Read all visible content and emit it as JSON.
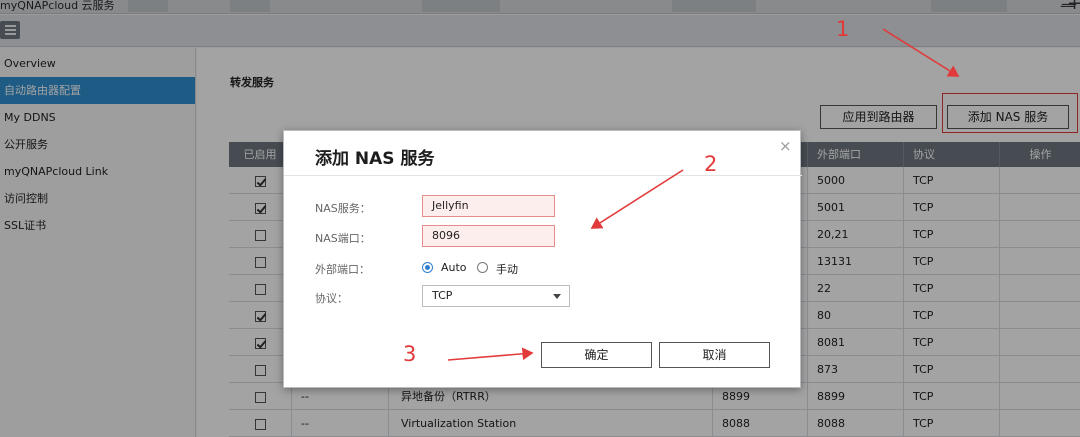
{
  "window": {
    "title": "myQNAPcloud 云服务",
    "minimize_glyph": "—",
    "add_glyph": "+"
  },
  "sidebar": {
    "items": [
      {
        "label": "Overview",
        "active": false
      },
      {
        "label": "自动路由器配置",
        "active": true
      },
      {
        "label": "My DDNS",
        "active": false
      },
      {
        "label": "公开服务",
        "active": false
      },
      {
        "label": "myQNAPcloud Link",
        "active": false
      },
      {
        "label": "访问控制",
        "active": false
      },
      {
        "label": "SSL证书",
        "active": false
      }
    ]
  },
  "main": {
    "section_title": "转发服务",
    "apply_button": "应用到路由器",
    "add_button": "添加 NAS 服务"
  },
  "table": {
    "headers": [
      "已启用",
      "",
      "",
      "",
      "外部端口",
      "协议",
      "操作"
    ],
    "rows": [
      {
        "enabled": true,
        "c2": "",
        "service": "",
        "nas_port": "",
        "ext_port": "5000",
        "protocol": "TCP"
      },
      {
        "enabled": true,
        "c2": "",
        "service": "",
        "nas_port": "",
        "ext_port": "5001",
        "protocol": "TCP"
      },
      {
        "enabled": false,
        "c2": "",
        "service": "",
        "nas_port": "",
        "ext_port": "20,21",
        "protocol": "TCP"
      },
      {
        "enabled": false,
        "c2": "",
        "service": "",
        "nas_port": "",
        "ext_port": "13131",
        "protocol": "TCP"
      },
      {
        "enabled": false,
        "c2": "",
        "service": "",
        "nas_port": "",
        "ext_port": "22",
        "protocol": "TCP"
      },
      {
        "enabled": true,
        "c2": "",
        "service": "",
        "nas_port": "",
        "ext_port": "80",
        "protocol": "TCP"
      },
      {
        "enabled": true,
        "c2": "",
        "service": "",
        "nas_port": "",
        "ext_port": "8081",
        "protocol": "TCP"
      },
      {
        "enabled": false,
        "c2": "",
        "service": "",
        "nas_port": "",
        "ext_port": "873",
        "protocol": "TCP"
      },
      {
        "enabled": false,
        "c2": "--",
        "service": "异地备份（RTRR）",
        "nas_port": "8899",
        "ext_port": "8899",
        "protocol": "TCP"
      },
      {
        "enabled": false,
        "c2": "--",
        "service": "Virtualization Station",
        "nas_port": "8088",
        "ext_port": "8088",
        "protocol": "TCP"
      }
    ]
  },
  "dialog": {
    "title": "添加 NAS 服务",
    "close_glyph": "×",
    "nas_service_label": "NAS服务：",
    "nas_service_value": "Jellyfin",
    "nas_port_label": "NAS端口：",
    "nas_port_value": "8096",
    "ext_port_label": "外部端口：",
    "radio_auto": "Auto",
    "radio_manual": "手动",
    "protocol_label": "协议：",
    "protocol_value": "TCP",
    "confirm": "确定",
    "cancel": "取消"
  },
  "annotations": {
    "step1": "1",
    "step2": "2",
    "step3": "3"
  },
  "colors": {
    "accent": "#2f8fd0",
    "header": "#6e7780",
    "annotation": "#e23a3a",
    "input_highlight": "#fdeeee"
  }
}
